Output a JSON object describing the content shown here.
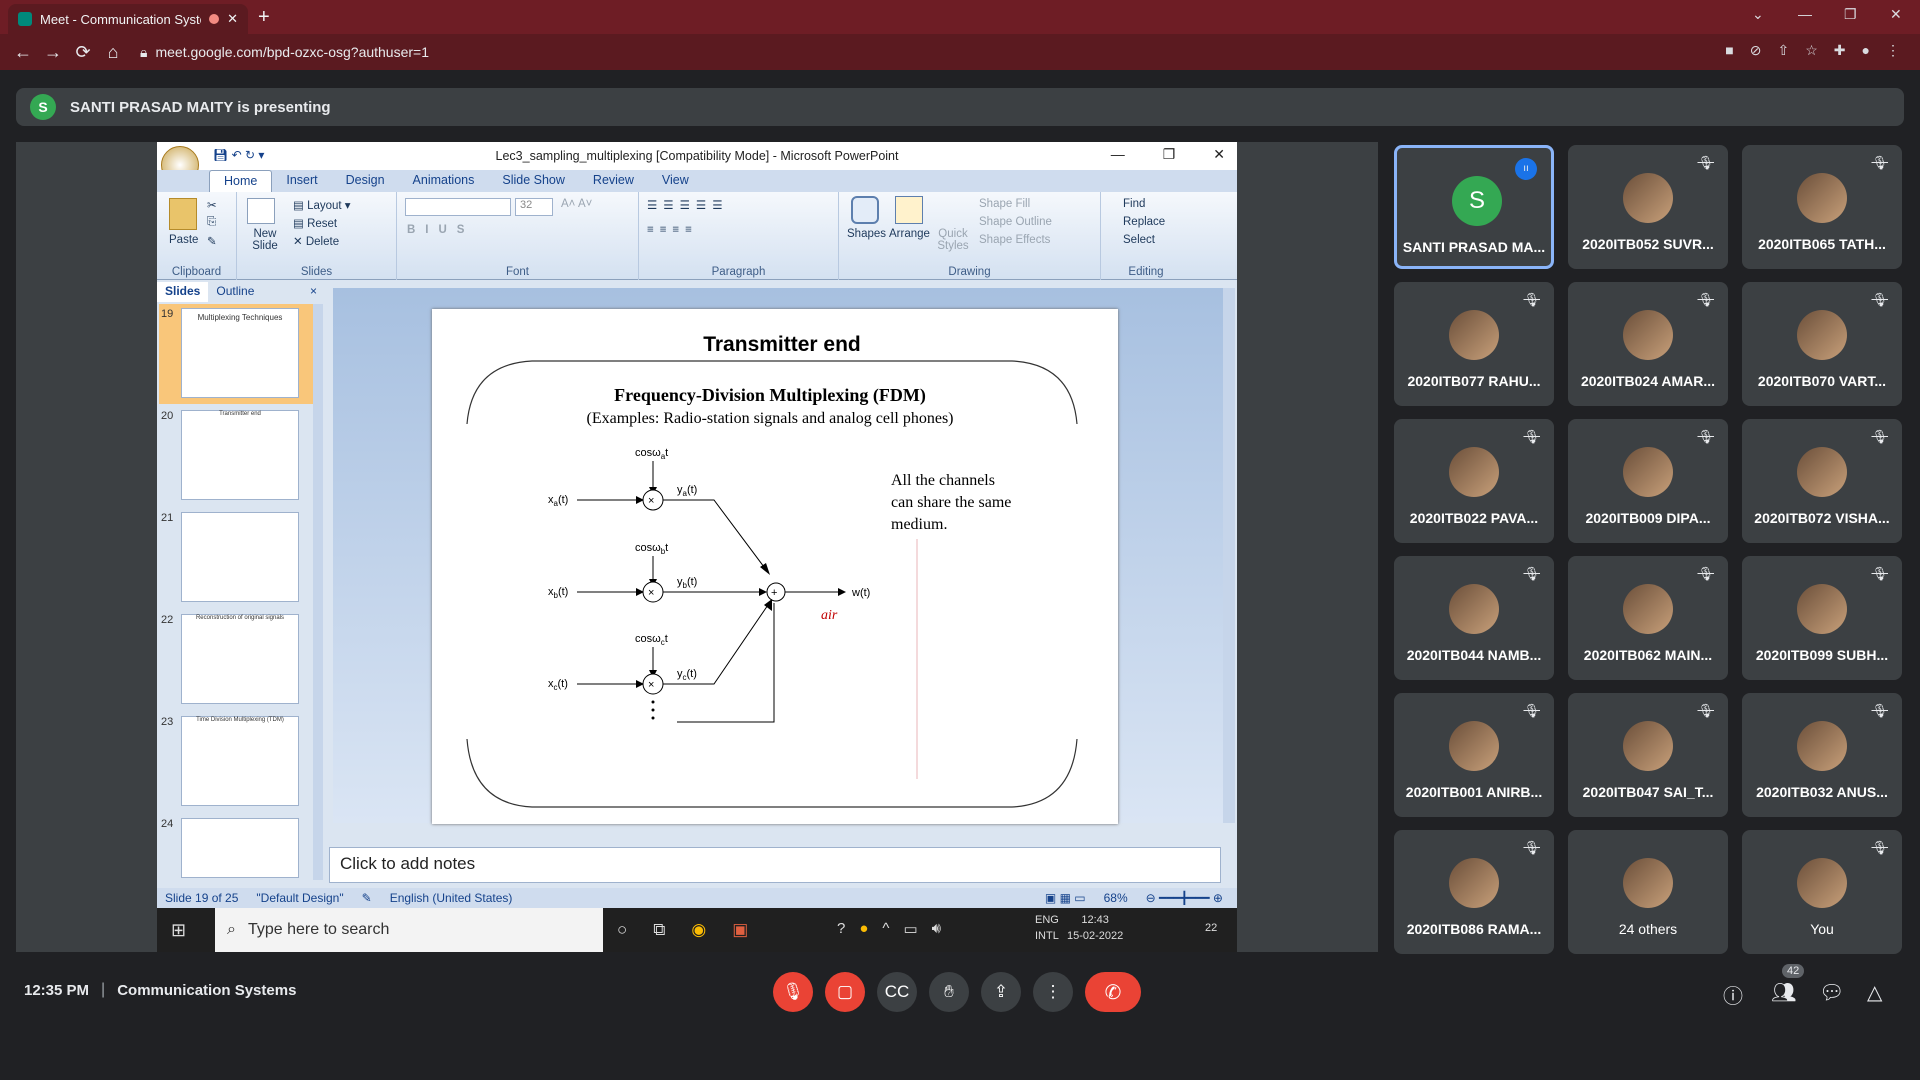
{
  "browser": {
    "tab_title": "Meet - Communication Syste",
    "url": "meet.google.com/bpd-ozxc-osg?authuser=1"
  },
  "presenting": {
    "initial": "S",
    "text": "SANTI PRASAD MAITY is presenting"
  },
  "ppt": {
    "window_title": "Lec3_sampling_multiplexing [Compatibility Mode] - Microsoft PowerPoint",
    "tabs": [
      "Home",
      "Insert",
      "Design",
      "Animations",
      "Slide Show",
      "Review",
      "View"
    ],
    "ribbon": {
      "paste": "Paste",
      "clipboard": "Clipboard",
      "layout": "Layout",
      "reset": "Reset",
      "delete": "Delete",
      "new_slide": "New Slide",
      "slides": "Slides",
      "font_size": "32",
      "font": "Font",
      "paragraph": "Paragraph",
      "shapes": "Shapes",
      "arrange": "Arrange",
      "quick_styles": "Quick Styles",
      "shape_fill": "Shape Fill",
      "shape_outline": "Shape Outline",
      "shape_effects": "Shape Effects",
      "drawing": "Drawing",
      "find": "Find",
      "replace": "Replace",
      "select": "Select",
      "editing": "Editing"
    },
    "panel_tabs": [
      "Slides",
      "Outline"
    ],
    "thumbs": [
      {
        "num": "19",
        "title": "Multiplexing Techniques"
      },
      {
        "num": "20",
        "title": "Transmitter end"
      },
      {
        "num": "21",
        "title": ""
      },
      {
        "num": "22",
        "title": "Reconstruction of original signals"
      },
      {
        "num": "23",
        "title": "Time Division Multiplexing (TDM)"
      },
      {
        "num": "24",
        "title": ""
      }
    ],
    "slide": {
      "title": "Transmitter end",
      "heading": "Frequency-Division Multiplexing (FDM)",
      "subheading": "(Examples: Radio-station signals and analog cell phones)",
      "note1": "All the channels",
      "note2": "can share the same",
      "note3": "medium.",
      "cos_a": "cosω",
      "sub_a": "a",
      "cos_b": "cosω",
      "sub_b": "b",
      "cos_c": "cosω",
      "sub_c": "c",
      "t": "t",
      "xa": "x",
      "xb": "x",
      "xc": "x",
      "ya": "y",
      "yb": "y",
      "yc": "y",
      "arg": "(t)",
      "wt": "w(t)",
      "air": "air"
    },
    "notes": "Click to add notes",
    "status": {
      "slide": "Slide 19 of 25",
      "design": "\"Default Design\"",
      "lang": "English (United States)",
      "zoom": "68%"
    },
    "taskbar": {
      "search": "Type here to search",
      "lang1": "ENG",
      "lang2": "INTL",
      "time": "12:43",
      "date": "15-02-2022",
      "notif": "22"
    }
  },
  "participants": [
    {
      "name": "SANTI PRASAD MA...",
      "initial": "S"
    },
    {
      "name": "2020ITB052 SUVR..."
    },
    {
      "name": "2020ITB065 TATH..."
    },
    {
      "name": "2020ITB077 RAHU..."
    },
    {
      "name": "2020ITB024 AMAR..."
    },
    {
      "name": "2020ITB070 VART..."
    },
    {
      "name": "2020ITB022 PAVA..."
    },
    {
      "name": "2020ITB009 DIPA..."
    },
    {
      "name": "2020ITB072 VISHA..."
    },
    {
      "name": "2020ITB044 NAMB..."
    },
    {
      "name": "2020ITB062 MAIN..."
    },
    {
      "name": "2020ITB099 SUBH..."
    },
    {
      "name": "2020ITB001 ANIRB..."
    },
    {
      "name": "2020ITB047 SAI_T..."
    },
    {
      "name": "2020ITB032 ANUS..."
    },
    {
      "name": "2020ITB086 RAMA..."
    },
    {
      "name": "24 others"
    },
    {
      "name": "You"
    }
  ],
  "meeting": {
    "time": "12:35 PM",
    "sep": "|",
    "name": "Communication Systems",
    "people_count": "42"
  },
  "colors": {
    "chrome": "#6e1d25",
    "meet_bg": "#202124",
    "tile": "#3c4043",
    "end_call": "#ea4335"
  }
}
